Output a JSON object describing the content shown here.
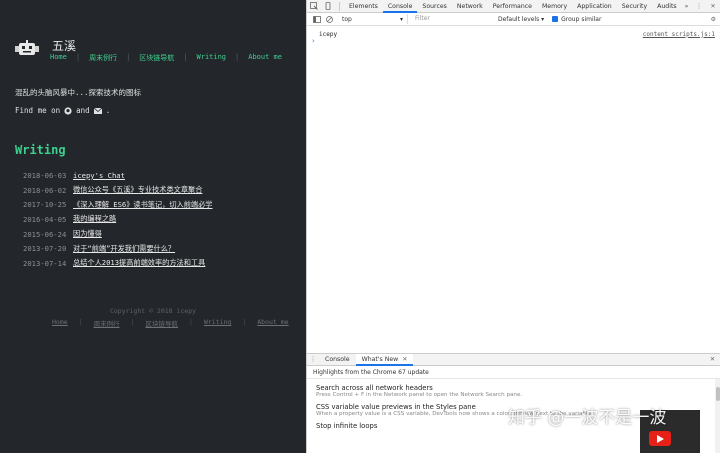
{
  "site": {
    "title": "五溪",
    "nav": [
      "Home",
      "周末例行",
      "区块链导航",
      "Writing",
      "About me"
    ],
    "tagline": "混乱的头脑风暴中...探索技术的图标",
    "findme_prefix": "Find me on",
    "findme_and": "and",
    "findme_end": ".",
    "section_title": "Writing",
    "posts": [
      {
        "date": "2018-06-03",
        "title": "icepy's Chat"
      },
      {
        "date": "2018-06-02",
        "title": "微信公众号《五溪》专业技术类文章聚合"
      },
      {
        "date": "2017-10-25",
        "title": "《深入理解 ES6》读书笔记，切入前端必学"
      },
      {
        "date": "2016-04-05",
        "title": "我的编程之路"
      },
      {
        "date": "2015-06-24",
        "title": "因为懂得"
      },
      {
        "date": "2013-07-20",
        "title": "对于“前端”开发我们需要什么？"
      },
      {
        "date": "2013-07-14",
        "title": "总结个人2013提高前端效率的方法和工具"
      }
    ],
    "copyright": "Copyright © 2018 icepy",
    "footer_nav": [
      "Home",
      "周末例行",
      "区块链导航",
      "Writing",
      "About me"
    ],
    "accent": "#3ecf8e",
    "background": "#23272b"
  },
  "devtools": {
    "tabs": [
      "Elements",
      "Console",
      "Sources",
      "Network",
      "Performance",
      "Memory",
      "Application",
      "Security",
      "Audits"
    ],
    "active_tab": "Console",
    "more": "»",
    "context": "top",
    "filter_placeholder": "Filter",
    "levels": "Default levels ▾",
    "group_similar": "Group similar",
    "console_message": "icepy",
    "console_source": "content_scripts.js:1",
    "prompt": "›",
    "drawer": {
      "tabs": [
        "Console",
        "What's New"
      ],
      "active": "What's New",
      "highlights": "Highlights from the Chrome 67 update",
      "items": [
        {
          "title": "Search across all network headers",
          "desc": "Press Control + F in the Network panel to open the Network Search pane."
        },
        {
          "title": "CSS variable value previews in the Styles pane",
          "desc": "When a property value is a CSS variable, DevTools now shows a color preview next to the variable."
        },
        {
          "title": "Stop infinite loops",
          "desc": ""
        }
      ]
    }
  },
  "watermark": "知乎 @一波不是一波"
}
